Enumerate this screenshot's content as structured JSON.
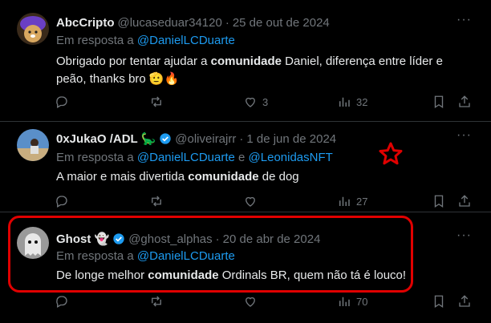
{
  "posts": [
    {
      "name": "AbcCripto",
      "handle": "@lucaseduar34120",
      "date": "25 de out de 2024",
      "reply_prefix": "Em resposta a ",
      "reply_mentions": [
        "@DanielLCDuarte"
      ],
      "reply_joiner": "",
      "text_before": "Obrigado por tentar ajudar a ",
      "text_bold": "comunidade",
      "text_after": " Daniel, diferença entre líder e peão, thanks bro 🫡🔥",
      "likes": "3",
      "views": "32",
      "avatar": "purple-cap-doge-avatar"
    },
    {
      "name": "0xJukaO /ADL 🦕",
      "handle": "@oliveirajrr",
      "date": "1 de jun de 2024",
      "reply_prefix": "Em resposta a ",
      "reply_mentions": [
        "@DanielLCDuarte",
        "@LeonidasNFT"
      ],
      "reply_joiner": " e ",
      "text_before": "A maior e mais divertida ",
      "text_bold": "comunidade",
      "text_after": " de dog",
      "likes": "",
      "views": "27",
      "verified": true,
      "avatar": "beach-photo-avatar"
    },
    {
      "name": "Ghost 👻",
      "handle": "@ghost_alphas",
      "date": "20 de abr de 2024",
      "reply_prefix": "Em resposta a ",
      "reply_mentions": [
        "@DanielLCDuarte"
      ],
      "reply_joiner": "",
      "text_before": "De longe melhor ",
      "text_bold": "comunidade",
      "text_after": " Ordinals BR, quem não tá é louco!",
      "likes": "",
      "views": "70",
      "verified": true,
      "avatar": "ghost-avatar"
    }
  ],
  "separator": "·",
  "more_label": "···",
  "colors": {
    "background": "#000000",
    "text": "#e7e9ea",
    "muted": "#71767b",
    "link": "#1d9bf0",
    "annotation": "#e00000"
  }
}
